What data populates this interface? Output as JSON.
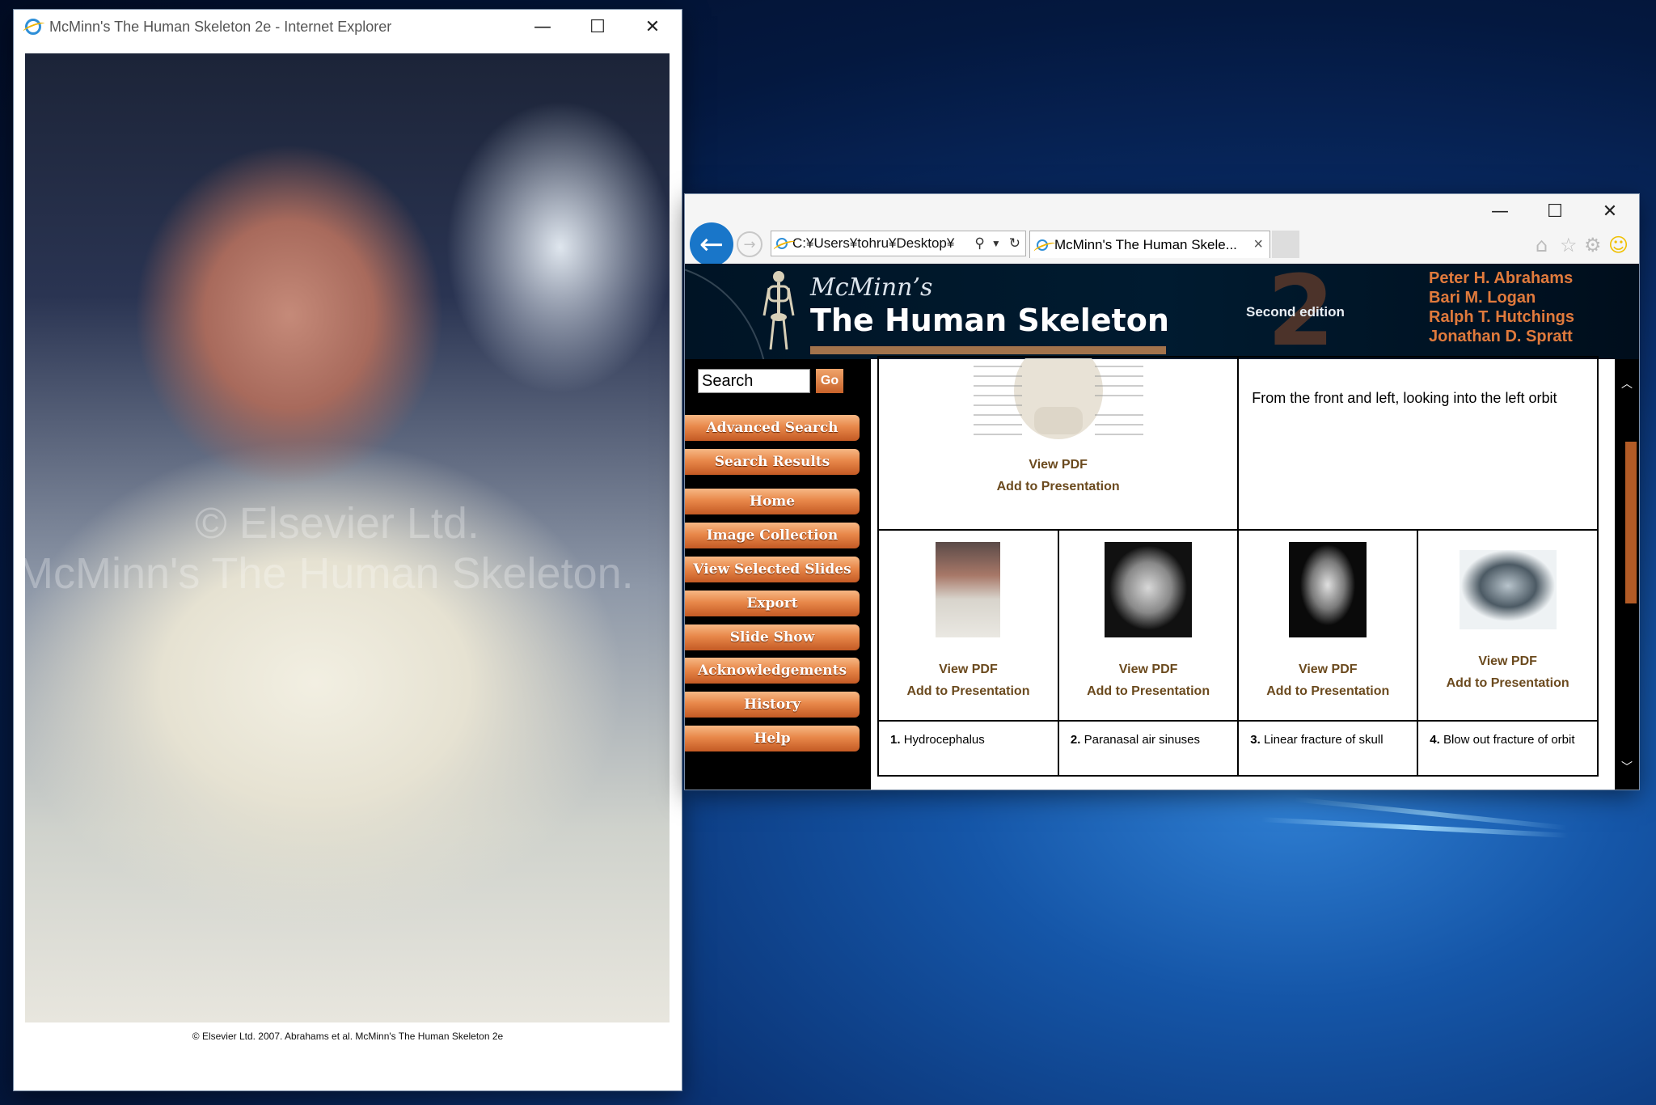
{
  "desktop": {
    "accent": "#1556a8"
  },
  "left_window": {
    "title": "McMinn's The Human Skeleton 2e - Internet Explorer",
    "watermark_line1": "© Elsevier Ltd.",
    "watermark_line2": "McMinn's The Human Skeleton.",
    "caption": "© Elsevier Ltd. 2007. Abrahams et al. McMinn's The Human Skeleton 2e",
    "controls": {
      "minimize": "—",
      "maximize": "☐",
      "close": "✕"
    }
  },
  "right_window": {
    "controls": {
      "minimize": "—",
      "maximize": "☐",
      "close": "✕"
    },
    "address": "C:¥Users¥tohru¥Desktop¥",
    "tab_title": "McMinn's The Human Skele...",
    "tab_close": "×",
    "toolbar_icons": [
      "home-icon",
      "star-icon",
      "gear-icon",
      "smiley-icon"
    ],
    "banner": {
      "subtitle": "McMinn’s",
      "title": "The Human Skeleton",
      "edition": "Second edition",
      "edition_numeral": "2",
      "authors": [
        "Peter H. Abrahams",
        "Bari M. Logan",
        "Ralph T. Hutchings",
        "Jonathan D. Spratt"
      ]
    },
    "search": {
      "placeholder": "Search",
      "go": "Go"
    },
    "nav": [
      "Advanced Search",
      "Search Results",
      "Home",
      "Image Collection",
      "View Selected Slides",
      "Export",
      "Slide Show",
      "Acknowledgements",
      "History",
      "Help"
    ],
    "top_row": {
      "view_pdf": "View PDF",
      "add": "Add to Presentation",
      "description": "From the front and left, looking into the left orbit"
    },
    "items": [
      {
        "num": "1.",
        "label": "Hydrocephalus",
        "view_pdf": "View PDF",
        "add": "Add to Presentation"
      },
      {
        "num": "2.",
        "label": "Paranasal air sinuses",
        "view_pdf": "View PDF",
        "add": "Add to Presentation"
      },
      {
        "num": "3.",
        "label": "Linear fracture of skull",
        "view_pdf": "View PDF",
        "add": "Add to Presentation"
      },
      {
        "num": "4.",
        "label": "Blow out fracture of orbit",
        "view_pdf": "View PDF",
        "add": "Add to Presentation"
      }
    ],
    "colors": {
      "nav_orange": "#e8884a",
      "author_orange": "#e07a3c",
      "link_brown": "#6b4a1e",
      "back_blue": "#1976c9"
    }
  }
}
